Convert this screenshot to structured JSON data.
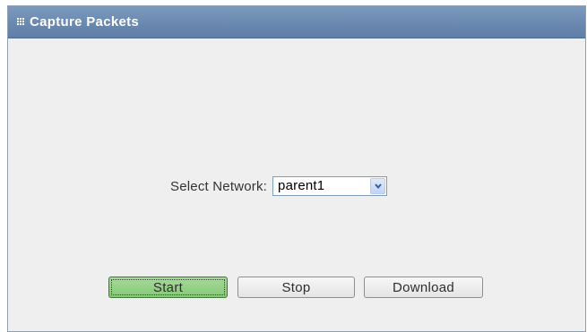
{
  "panel": {
    "title": "Capture Packets",
    "header_icon": "grip-icon"
  },
  "network": {
    "label": "Select Network:",
    "selected": "parent1",
    "dropdown_icon": "chevron-down-icon"
  },
  "actions": {
    "start_label": "Start",
    "stop_label": "Stop",
    "download_label": "Download"
  },
  "colors": {
    "header_bg": "#6a89b1",
    "panel_bg": "#efefef",
    "start_bg": "#86c878"
  }
}
